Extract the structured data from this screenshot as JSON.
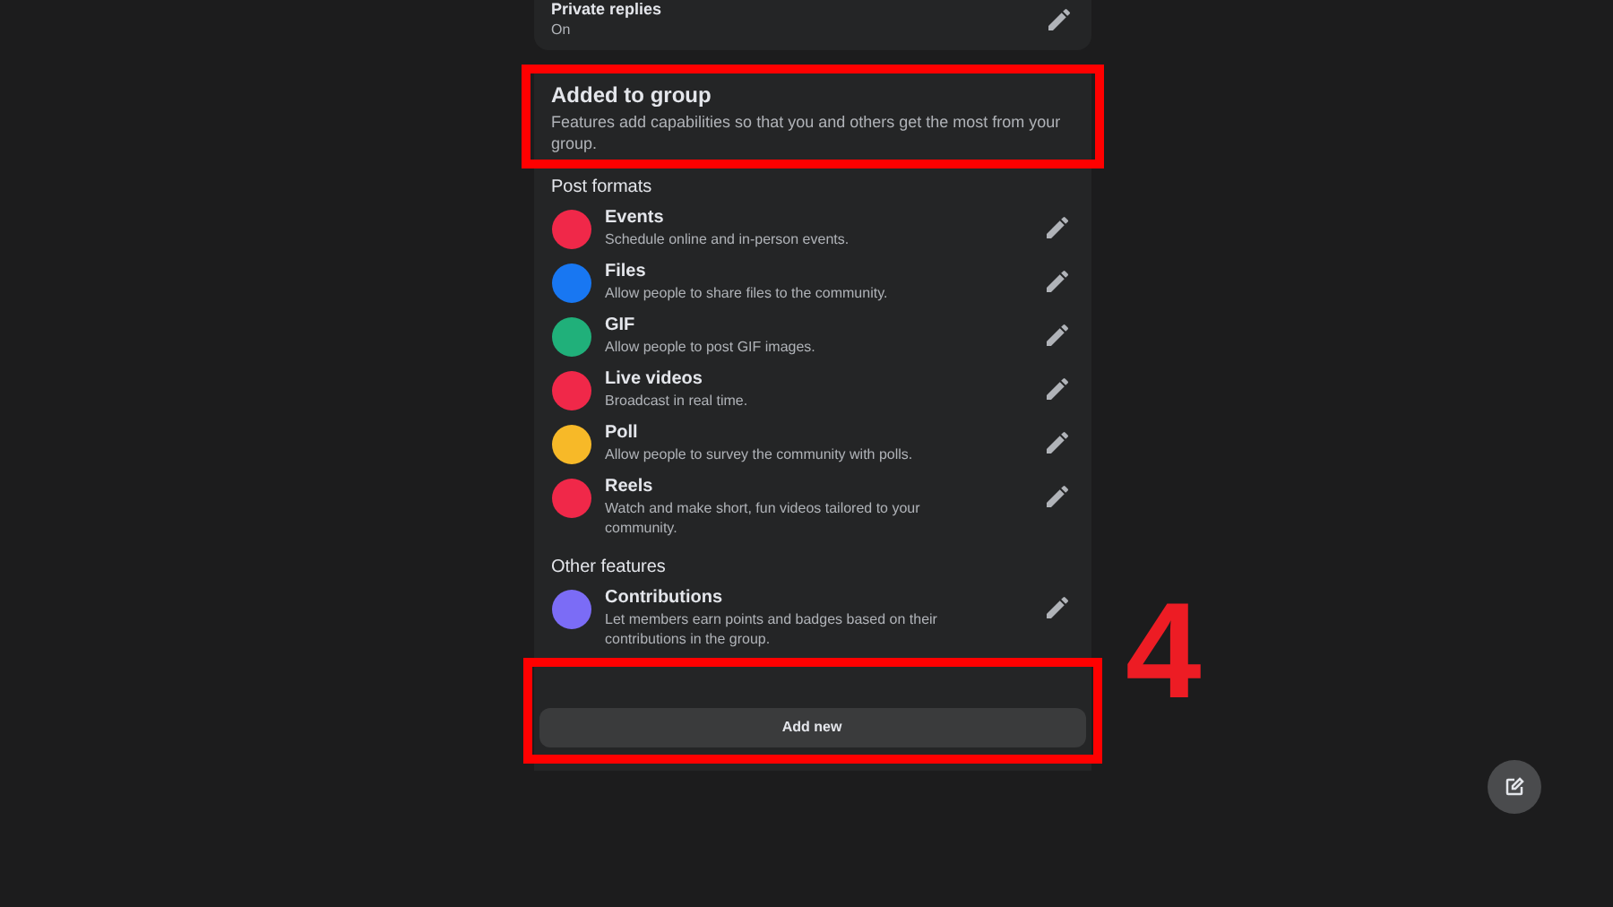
{
  "top_setting": {
    "title": "Private replies",
    "value": "On"
  },
  "header": {
    "title": "Added to group",
    "description": "Features add capabilities so that you and others get the most from your group."
  },
  "sections": [
    {
      "label": "Post formats",
      "items": [
        {
          "title": "Events",
          "description": "Schedule online and in-person events.",
          "color": "#f02849"
        },
        {
          "title": "Files",
          "description": "Allow people to share files to the community.",
          "color": "#1877f2"
        },
        {
          "title": "GIF",
          "description": "Allow people to post GIF images.",
          "color": "#20b07a"
        },
        {
          "title": "Live videos",
          "description": "Broadcast in real time.",
          "color": "#f02849"
        },
        {
          "title": "Poll",
          "description": "Allow people to survey the community with polls.",
          "color": "#f7b928"
        },
        {
          "title": "Reels",
          "description": "Watch and make short, fun videos tailored to your community.",
          "color": "#f02849"
        }
      ]
    },
    {
      "label": "Other features",
      "items": [
        {
          "title": "Contributions",
          "description": "Let members earn points and badges based on their contributions in the group.",
          "color": "#7b6cf6"
        }
      ]
    }
  ],
  "add_button": "Add new",
  "annotation_number": "4"
}
